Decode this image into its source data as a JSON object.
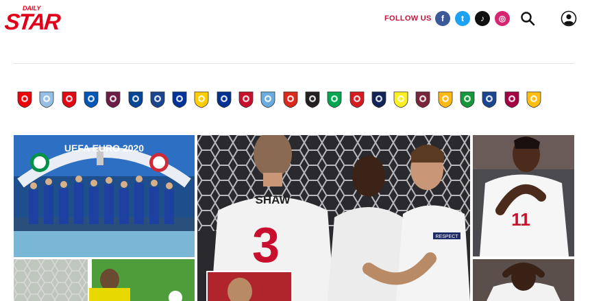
{
  "header": {
    "logo_top": "DAILY",
    "logo_main": "STAR",
    "follow_label": "FOLLOW US",
    "social": [
      {
        "icon": "facebook-icon",
        "glyph": "f",
        "color": "#3b5998"
      },
      {
        "icon": "twitter-icon",
        "glyph": "t",
        "color": "#1da1f2"
      },
      {
        "icon": "tiktok-icon",
        "glyph": "♪",
        "color": "#111111"
      },
      {
        "icon": "instagram-icon",
        "glyph": "◎",
        "color": "#d6266f"
      }
    ],
    "search_icon": "search-icon",
    "account_icon": "user-icon"
  },
  "clubs": [
    {
      "icon": "arsenal-crest-icon",
      "color": "#ef0107"
    },
    {
      "icon": "aston-villa-crest-icon",
      "color": "#95bfe5"
    },
    {
      "icon": "brentford-crest-icon",
      "color": "#e30613"
    },
    {
      "icon": "brighton-crest-icon",
      "color": "#0057b8"
    },
    {
      "icon": "burnley-crest-icon",
      "color": "#6c1d45"
    },
    {
      "icon": "chelsea-crest-icon",
      "color": "#034694"
    },
    {
      "icon": "crystal-palace-crest-icon",
      "color": "#1b458f"
    },
    {
      "icon": "everton-crest-icon",
      "color": "#003399"
    },
    {
      "icon": "leeds-crest-icon",
      "color": "#ffcd00"
    },
    {
      "icon": "leicester-crest-icon",
      "color": "#003090"
    },
    {
      "icon": "liverpool-crest-icon",
      "color": "#c8102e"
    },
    {
      "icon": "man-city-crest-icon",
      "color": "#6cabdd"
    },
    {
      "icon": "man-united-crest-icon",
      "color": "#da291c"
    },
    {
      "icon": "newcastle-crest-icon",
      "color": "#241f20"
    },
    {
      "icon": "norwich-crest-icon",
      "color": "#00a650"
    },
    {
      "icon": "southampton-crest-icon",
      "color": "#d71920"
    },
    {
      "icon": "tottenham-crest-icon",
      "color": "#132257"
    },
    {
      "icon": "watford-crest-icon",
      "color": "#fbee23"
    },
    {
      "icon": "west-ham-crest-icon",
      "color": "#7a263a"
    },
    {
      "icon": "wolves-crest-icon",
      "color": "#fdb913"
    },
    {
      "icon": "celtic-crest-icon",
      "color": "#16973b"
    },
    {
      "icon": "rangers-crest-icon",
      "color": "#1b458f"
    },
    {
      "icon": "barcelona-crest-icon",
      "color": "#a50044"
    },
    {
      "icon": "real-madrid-crest-icon",
      "color": "#febe10"
    }
  ],
  "photos": {
    "euro_banner": "UEFA EURO 2020",
    "shirt_name": "SHAW",
    "shirt_number": "3",
    "shirt_number_2": "11",
    "sleeve_text": "RESPECT"
  }
}
